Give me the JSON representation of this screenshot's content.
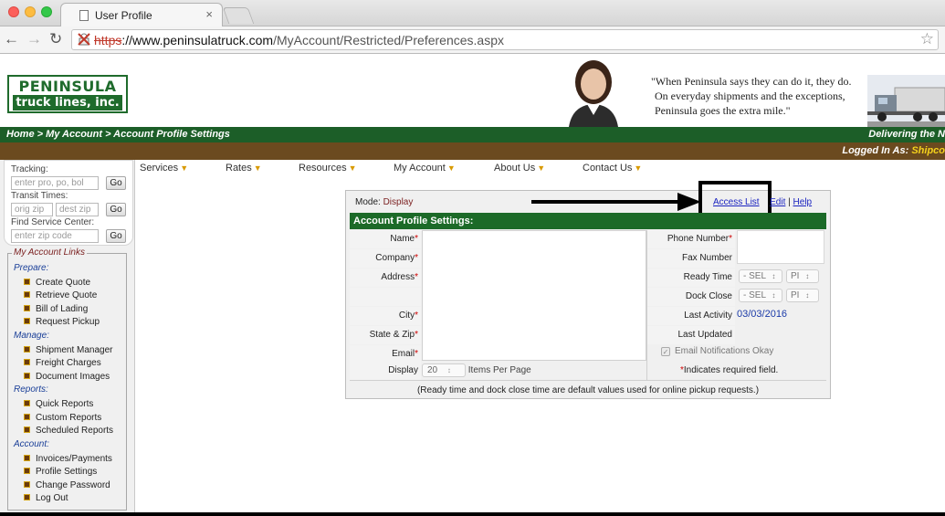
{
  "browser": {
    "tab_title": "User Profile",
    "tab_close": "×",
    "url_scheme": "https",
    "url_host_prefix": "://www.peninsulatruck.com",
    "url_path": "/MyAccount/Restricted/Preferences.aspx"
  },
  "header": {
    "logo_line1": "PENINSULA",
    "logo_line2": "truck lines, inc.",
    "quote_line1": "\"When Peninsula says they can do it, they do.",
    "quote_line2": "On everyday shipments and the exceptions,",
    "quote_line3": "Peninsula goes the extra mile.\""
  },
  "breadcrumb": {
    "text": "Home > My Account > Account Profile Settings",
    "tagline": "Delivering the N"
  },
  "user_bar": {
    "label": "Logged In As:",
    "username": "Shipco"
  },
  "quick": {
    "tracking_label": "Tracking:",
    "tracking_placeholder": "enter pro, po, bol",
    "transit_label": "Transit Times:",
    "orig_placeholder": "orig zip",
    "dest_placeholder": "dest zip",
    "service_label": "Find Service Center:",
    "service_placeholder": "enter zip code",
    "go": "Go"
  },
  "sidebar": {
    "legend": "My Account Links",
    "groups": [
      {
        "label": "Prepare:",
        "items": [
          "Create Quote",
          "Retrieve Quote",
          "Bill of Lading",
          "Request Pickup"
        ]
      },
      {
        "label": "Manage:",
        "items": [
          "Shipment Manager",
          "Freight Charges",
          "Document Images"
        ]
      },
      {
        "label": "Reports:",
        "items": [
          "Quick Reports",
          "Custom Reports",
          "Scheduled Reports"
        ]
      },
      {
        "label": "Account:",
        "items": [
          "Invoices/Payments",
          "Profile Settings",
          "Change Password",
          "Log Out"
        ]
      }
    ]
  },
  "topnav": [
    "Services",
    "Rates",
    "Resources",
    "My Account",
    "About Us",
    "Contact Us"
  ],
  "panel": {
    "mode_label": "Mode:",
    "mode_value": "Display",
    "access_list": "Access List",
    "edit": "Edit",
    "help": "Help",
    "separator": "|",
    "title": "Account Profile Settings:",
    "left_labels": [
      "Name",
      "Company",
      "Address",
      "",
      "City",
      "State & Zip",
      "Email"
    ],
    "left_required": [
      true,
      true,
      true,
      false,
      true,
      true,
      true
    ],
    "display_label": "Display",
    "display_value": "20",
    "items_per_page": "Items Per Page",
    "right_labels": [
      "Phone Number",
      "Fax Number",
      "Ready Time",
      "Dock Close",
      "Last Activity",
      "Last Updated"
    ],
    "right_required": [
      true,
      false,
      false,
      false,
      false,
      false
    ],
    "select_sel": "- SEL",
    "select_pm": "PI",
    "last_activity": "03/03/2016",
    "email_notifications": "Email Notifications Okay",
    "required_note": "Indicates required field.",
    "footnote": "(Ready time and dock close time are default values used for online pickup requests.)"
  },
  "colors": {
    "brand_green": "#1c6a28",
    "brand_brown": "#6b4a1f",
    "link_blue": "#1a23c0",
    "required_red": "#c00000"
  }
}
